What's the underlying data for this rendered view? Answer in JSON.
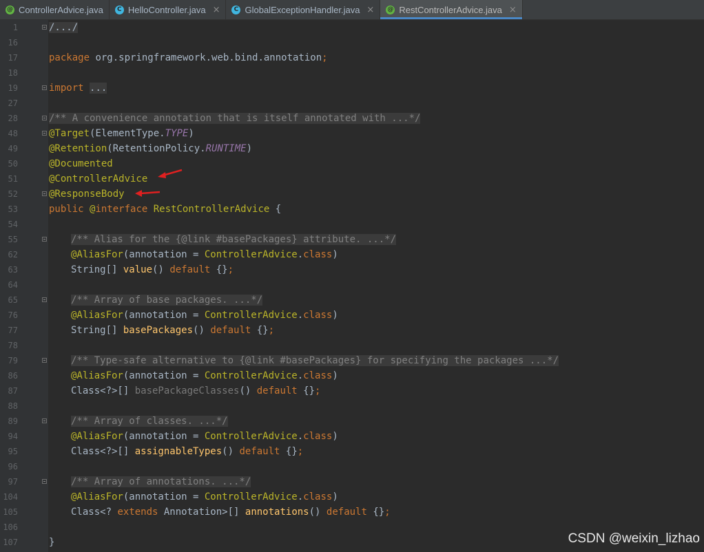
{
  "tabs": [
    {
      "label": "ControllerAdvice.java",
      "icon": "annotation-file-icon",
      "active": false,
      "closable": false
    },
    {
      "label": "HelloController.java",
      "icon": "class-file-icon",
      "active": false,
      "closable": true
    },
    {
      "label": "GlobalExceptionHandler.java",
      "icon": "class-file-icon",
      "active": false,
      "closable": true
    },
    {
      "label": "RestControllerAdvice.java",
      "icon": "annotation-file-icon",
      "active": true,
      "closable": true
    }
  ],
  "colors": {
    "keyword": "#cc7832",
    "annotation": "#bbb529",
    "comment": "#808080",
    "constant": "#9876aa",
    "method": "#ffc66d",
    "text": "#a9b7c6",
    "arrow": "#e02020",
    "active_tab_underline": "#4a88c7"
  },
  "code": {
    "lines": [
      {
        "num": "1",
        "fold": true,
        "indent": 0,
        "tokens": [
          {
            "t": "/.../",
            "c": "collapsed"
          }
        ]
      },
      {
        "num": "16",
        "fold": false,
        "indent": 0,
        "tokens": []
      },
      {
        "num": "17",
        "fold": false,
        "indent": 0,
        "tokens": [
          {
            "t": "package ",
            "c": "kw"
          },
          {
            "t": "org.springframework.web.bind.annotation"
          },
          {
            "t": ";",
            "c": "kw"
          }
        ]
      },
      {
        "num": "18",
        "fold": false,
        "indent": 0,
        "tokens": []
      },
      {
        "num": "19",
        "fold": true,
        "indent": 0,
        "tokens": [
          {
            "t": "import ",
            "c": "kw"
          },
          {
            "t": "...",
            "c": "collapsed"
          }
        ]
      },
      {
        "num": "27",
        "fold": false,
        "indent": 0,
        "tokens": []
      },
      {
        "num": "28",
        "fold": true,
        "indent": 0,
        "tokens": [
          {
            "t": "/** A convenience annotation that is itself annotated with ...*/",
            "c": "cm"
          }
        ]
      },
      {
        "num": "48",
        "fold": true,
        "indent": 0,
        "tokens": [
          {
            "t": "@Target",
            "c": "an"
          },
          {
            "t": "(ElementType."
          },
          {
            "t": "TYPE",
            "c": "it"
          },
          {
            "t": ")"
          }
        ]
      },
      {
        "num": "49",
        "fold": false,
        "indent": 0,
        "tokens": [
          {
            "t": "@Retention",
            "c": "an"
          },
          {
            "t": "(RetentionPolicy."
          },
          {
            "t": "RUNTIME",
            "c": "it"
          },
          {
            "t": ")"
          }
        ]
      },
      {
        "num": "50",
        "fold": false,
        "indent": 0,
        "tokens": [
          {
            "t": "@Documented",
            "c": "an"
          }
        ]
      },
      {
        "num": "51",
        "fold": false,
        "indent": 0,
        "tokens": [
          {
            "t": "@ControllerAdvice",
            "c": "an"
          }
        ]
      },
      {
        "num": "52",
        "fold": true,
        "indent": 0,
        "tokens": [
          {
            "t": "@ResponseBody",
            "c": "an"
          }
        ]
      },
      {
        "num": "53",
        "fold": false,
        "indent": 0,
        "tokens": [
          {
            "t": "public ",
            "c": "kw"
          },
          {
            "t": "@",
            "c": "an"
          },
          {
            "t": "interface ",
            "c": "kw"
          },
          {
            "t": "RestControllerAdvice",
            "c": "an"
          },
          {
            "t": " {"
          }
        ]
      },
      {
        "num": "54",
        "fold": false,
        "indent": 0,
        "tokens": []
      },
      {
        "num": "55",
        "fold": true,
        "indent": 1,
        "tokens": [
          {
            "t": "/** Alias for the {@link #basePackages} attribute. ...*/",
            "c": "cm"
          }
        ]
      },
      {
        "num": "62",
        "fold": false,
        "indent": 1,
        "tokens": [
          {
            "t": "@AliasFor",
            "c": "an"
          },
          {
            "t": "(annotation = "
          },
          {
            "t": "ControllerAdvice",
            "c": "an"
          },
          {
            "t": "."
          },
          {
            "t": "class",
            "c": "kw"
          },
          {
            "t": ")"
          }
        ]
      },
      {
        "num": "63",
        "fold": false,
        "indent": 1,
        "tokens": [
          {
            "t": "String[] "
          },
          {
            "t": "value",
            "c": "fn"
          },
          {
            "t": "() "
          },
          {
            "t": "default ",
            "c": "kw"
          },
          {
            "t": "{}"
          },
          {
            "t": ";",
            "c": "kw"
          }
        ]
      },
      {
        "num": "64",
        "fold": false,
        "indent": 0,
        "tokens": []
      },
      {
        "num": "65",
        "fold": true,
        "indent": 1,
        "tokens": [
          {
            "t": "/** Array of base packages. ...*/",
            "c": "cm"
          }
        ]
      },
      {
        "num": "76",
        "fold": false,
        "indent": 1,
        "tokens": [
          {
            "t": "@AliasFor",
            "c": "an"
          },
          {
            "t": "(annotation = "
          },
          {
            "t": "ControllerAdvice",
            "c": "an"
          },
          {
            "t": "."
          },
          {
            "t": "class",
            "c": "kw"
          },
          {
            "t": ")"
          }
        ]
      },
      {
        "num": "77",
        "fold": false,
        "indent": 1,
        "tokens": [
          {
            "t": "String[] "
          },
          {
            "t": "basePackages",
            "c": "fn"
          },
          {
            "t": "() "
          },
          {
            "t": "default ",
            "c": "kw"
          },
          {
            "t": "{}"
          },
          {
            "t": ";",
            "c": "kw"
          }
        ]
      },
      {
        "num": "78",
        "fold": false,
        "indent": 0,
        "tokens": []
      },
      {
        "num": "79",
        "fold": true,
        "indent": 1,
        "tokens": [
          {
            "t": "/** Type-safe alternative to {@link #basePackages} for specifying the packages ...*/",
            "c": "cm"
          }
        ]
      },
      {
        "num": "86",
        "fold": false,
        "indent": 1,
        "tokens": [
          {
            "t": "@AliasFor",
            "c": "an"
          },
          {
            "t": "(annotation = "
          },
          {
            "t": "ControllerAdvice",
            "c": "an"
          },
          {
            "t": "."
          },
          {
            "t": "class",
            "c": "kw"
          },
          {
            "t": ")"
          }
        ]
      },
      {
        "num": "87",
        "fold": false,
        "indent": 1,
        "tokens": [
          {
            "t": "Class<?>[] "
          },
          {
            "t": "basePackageClasses",
            "c": "gy"
          },
          {
            "t": "() "
          },
          {
            "t": "default ",
            "c": "kw"
          },
          {
            "t": "{}"
          },
          {
            "t": ";",
            "c": "kw"
          }
        ]
      },
      {
        "num": "88",
        "fold": false,
        "indent": 0,
        "tokens": []
      },
      {
        "num": "89",
        "fold": true,
        "indent": 1,
        "tokens": [
          {
            "t": "/** Array of classes. ...*/",
            "c": "cm"
          }
        ]
      },
      {
        "num": "94",
        "fold": false,
        "indent": 1,
        "tokens": [
          {
            "t": "@AliasFor",
            "c": "an"
          },
          {
            "t": "(annotation = "
          },
          {
            "t": "ControllerAdvice",
            "c": "an"
          },
          {
            "t": "."
          },
          {
            "t": "class",
            "c": "kw"
          },
          {
            "t": ")"
          }
        ]
      },
      {
        "num": "95",
        "fold": false,
        "indent": 1,
        "tokens": [
          {
            "t": "Class<?>[] "
          },
          {
            "t": "assignableTypes",
            "c": "fn"
          },
          {
            "t": "() "
          },
          {
            "t": "default ",
            "c": "kw"
          },
          {
            "t": "{}"
          },
          {
            "t": ";",
            "c": "kw"
          }
        ]
      },
      {
        "num": "96",
        "fold": false,
        "indent": 0,
        "tokens": []
      },
      {
        "num": "97",
        "fold": true,
        "indent": 1,
        "tokens": [
          {
            "t": "/** Array of annotations. ...*/",
            "c": "cm"
          }
        ]
      },
      {
        "num": "104",
        "fold": false,
        "indent": 1,
        "tokens": [
          {
            "t": "@AliasFor",
            "c": "an"
          },
          {
            "t": "(annotation = "
          },
          {
            "t": "ControllerAdvice",
            "c": "an"
          },
          {
            "t": "."
          },
          {
            "t": "class",
            "c": "kw"
          },
          {
            "t": ")"
          }
        ]
      },
      {
        "num": "105",
        "fold": false,
        "indent": 1,
        "tokens": [
          {
            "t": "Class<? "
          },
          {
            "t": "extends ",
            "c": "kw"
          },
          {
            "t": "Annotation>[] "
          },
          {
            "t": "annotations",
            "c": "fn"
          },
          {
            "t": "() "
          },
          {
            "t": "default ",
            "c": "kw"
          },
          {
            "t": "{}"
          },
          {
            "t": ";",
            "c": "kw"
          }
        ]
      },
      {
        "num": "106",
        "fold": false,
        "indent": 0,
        "tokens": []
      },
      {
        "num": "107",
        "fold": false,
        "indent": 0,
        "tokens": [
          {
            "t": "}"
          }
        ]
      }
    ]
  },
  "watermark": "CSDN @weixin_lizhao"
}
